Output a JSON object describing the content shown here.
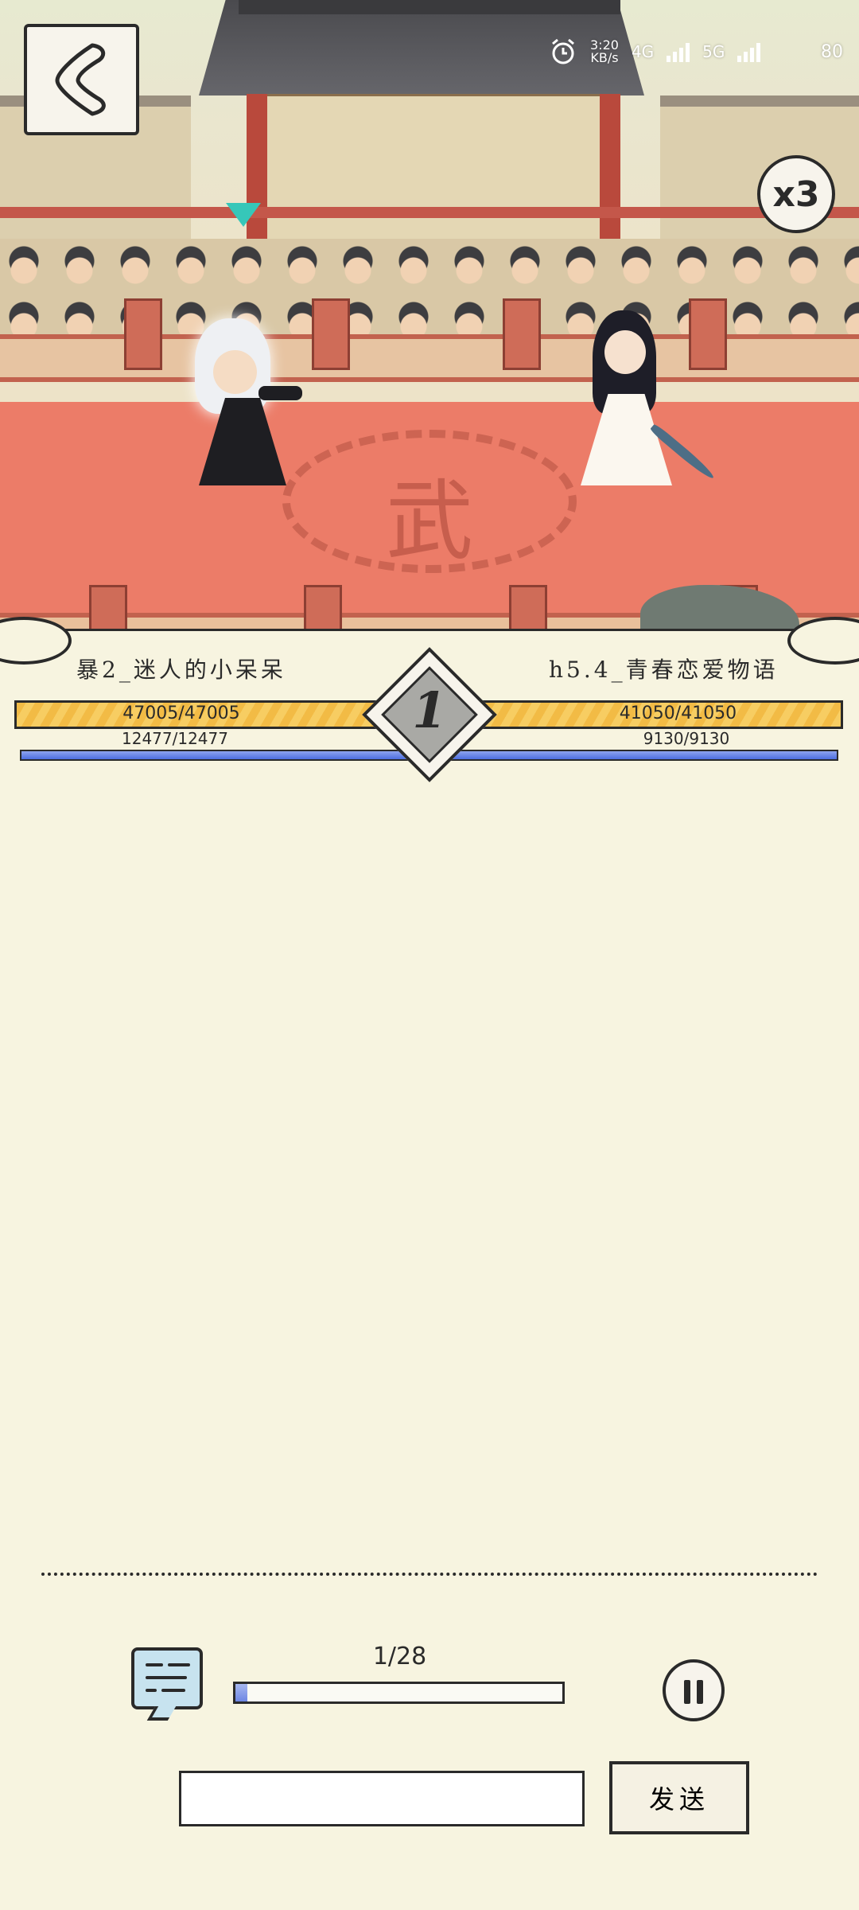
{
  "status_bar": {
    "time": "3:20",
    "speed_unit": "KB/s",
    "network_left": "4G",
    "network_right": "5G",
    "battery": "80"
  },
  "arena": {
    "emblem_char": "武",
    "speed_multiplier": "x3"
  },
  "players": {
    "left": {
      "name": "暴2_迷人的小呆呆",
      "hp_text": "47005/47005",
      "hp": 47005,
      "hp_max": 47005,
      "mp_text": "12477/12477",
      "mp": 12477,
      "mp_max": 12477
    },
    "right": {
      "name": "h5.4_青春恋爱物语",
      "hp_text": "41050/41050",
      "hp": 41050,
      "hp_max": 41050,
      "mp_text": "9130/9130",
      "mp": 9130,
      "mp_max": 9130
    }
  },
  "round": {
    "number": "1"
  },
  "playback": {
    "progress_text": "1/28",
    "current": 1,
    "total": 28
  },
  "chat": {
    "input_value": "",
    "send_label": "发送"
  },
  "colors": {
    "hp_bar": "#f2bb45",
    "mp_bar": "#4d6ee0",
    "stage_floor": "#ec7c68",
    "turn_marker": "#36c7b9"
  },
  "icons": {
    "back": "back-arrow-icon",
    "chat": "chat-bubble-icon",
    "pause": "pause-icon",
    "alarm": "alarm-icon"
  }
}
